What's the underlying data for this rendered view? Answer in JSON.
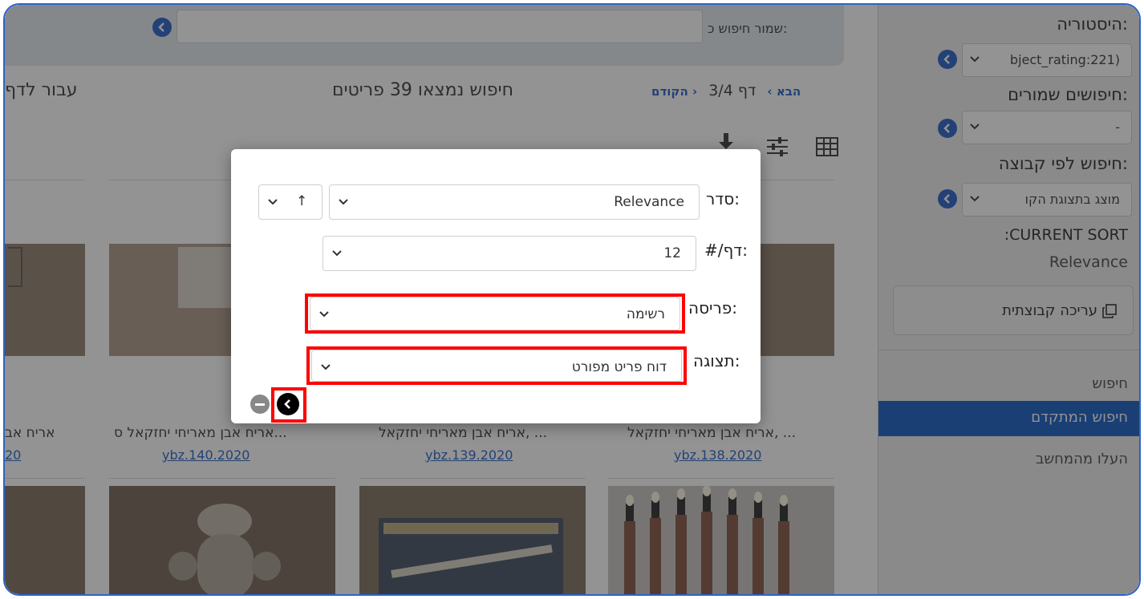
{
  "search": {
    "save_label": "שמור חיפוש כ:",
    "save_value": ""
  },
  "pager": {
    "prev": "‹ הקודם",
    "page_info": "דף 3/4",
    "next": "הבא ›",
    "results": "חיפוש נמצאו 39 פריטים",
    "jump": "עבור לדף"
  },
  "toolbar": {
    "icons": [
      "table-view-icon",
      "filter-sliders-icon",
      "download-icon"
    ]
  },
  "items": [
    {
      "title": "אריח אבן מאריחי יחזקאל, ...",
      "id": "ybz.138.2020"
    },
    {
      "title": "אריח אבן מאריחי יחזקאל, ...",
      "id": "ybz.139.2020"
    },
    {
      "title": "אריח אבן מאריחי יחזקאל ס...",
      "id": "ybz.140.2020"
    },
    {
      "title": "אריח אב",
      "id": "20"
    }
  ],
  "sidebar": {
    "history_label": "היסטוריה:",
    "history_value": "bject_rating:221)",
    "saved_label": "חיפושים שמורים:",
    "saved_value": "-",
    "group_label": "חיפוש לפי קבוצה:",
    "group_value": "מוצג בתצוגת הקו",
    "current_sort_label": ":CURRENT SORT",
    "current_sort_value": "Relevance",
    "bulk_edit": "עריכה קבוצתית",
    "nav": [
      "חיפוש",
      "חיפוש המתקדם",
      "העלו מהמחשב"
    ]
  },
  "modal": {
    "sort_label": "סדר:",
    "sort_value": "Relevance",
    "direction_value": "↑",
    "per_page_label": "#/דף:",
    "per_page_value": "12",
    "layout_label": "פריסה:",
    "layout_value": "רשימה",
    "display_label": "תצוגה:",
    "display_value": "דוח פריט מפורט"
  },
  "colors": {
    "accent": "#1f5bc4",
    "nav_active": "#0a57c2",
    "highlight": "#ff0000"
  }
}
